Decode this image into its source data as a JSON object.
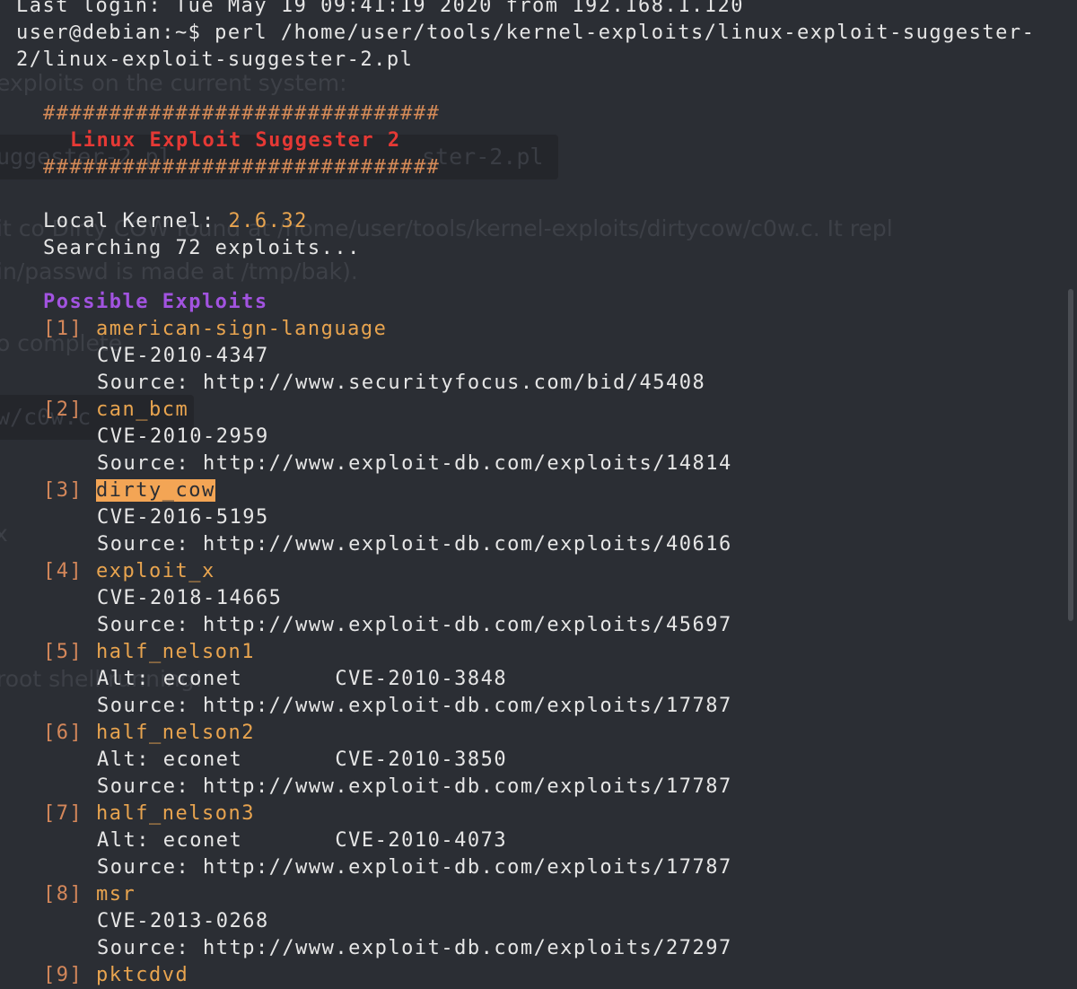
{
  "terminal": {
    "cut_line": "Last login: Tue May 19 09:41:19 2020 from 192.168.1.120",
    "prompt": "user@debian:~$ perl /home/user/tools/kernel-exploits/linux-exploit-suggester-",
    "prompt_cont": "2/linux-exploit-suggester-2.pl",
    "hash_bar": "##############################",
    "banner": "Linux Exploit Suggester 2",
    "kernel_label": "Local Kernel: ",
    "kernel_version": "2.6.32",
    "searching": "Searching 72 exploits...",
    "possible_label": "Possible Exploits",
    "exploits": [
      {
        "index": "[1]",
        "name": "american-sign-language",
        "cve": "CVE-2010-4347",
        "source": "Source: http://www.securityfocus.com/bid/45408"
      },
      {
        "index": "[2]",
        "name": "can_bcm",
        "cve": "CVE-2010-2959",
        "source": "Source: http://www.exploit-db.com/exploits/14814"
      },
      {
        "index": "[3]",
        "name": "dirty_cow",
        "cve": "CVE-2016-5195",
        "source": "Source: http://www.exploit-db.com/exploits/40616"
      },
      {
        "index": "[4]",
        "name": "exploit_x",
        "cve": "CVE-2018-14665",
        "source": "Source: http://www.exploit-db.com/exploits/45697"
      },
      {
        "index": "[5]",
        "name": "half_nelson1",
        "alt": "Alt: econet       CVE-2010-3848",
        "source": "Source: http://www.exploit-db.com/exploits/17787"
      },
      {
        "index": "[6]",
        "name": "half_nelson2",
        "alt": "Alt: econet       CVE-2010-3850",
        "source": "Source: http://www.exploit-db.com/exploits/17787"
      },
      {
        "index": "[7]",
        "name": "half_nelson3",
        "alt": "Alt: econet       CVE-2010-4073",
        "source": "Source: http://www.exploit-db.com/exploits/17787"
      },
      {
        "index": "[8]",
        "name": "msr",
        "cve": "CVE-2013-0268",
        "source": "Source: http://www.exploit-db.com/exploits/27297"
      },
      {
        "index": "[9]",
        "name": "pktcdvd"
      }
    ]
  },
  "background": {
    "line1": "exploits on the current system:",
    "line2": "uggester-2.pl",
    "line2b": "ster-2.pl",
    "line3": "it co      Dirty COW      found at /home/user/tools/kernel-exploits/dirtycow/c0w.c. It repl",
    "line4": "in/passwd is made at /tmp/bak).",
    "line5": "o complete.",
    "line6": "w/c0w.c",
    "line7": "x",
    "line8": "root shell      running!"
  },
  "colors": {
    "background": "#2b2e34",
    "hash": "#d48a57",
    "banner": "#e53935",
    "version": "#e8a44f",
    "possible": "#a253e0",
    "highlight": "#f3a555"
  }
}
